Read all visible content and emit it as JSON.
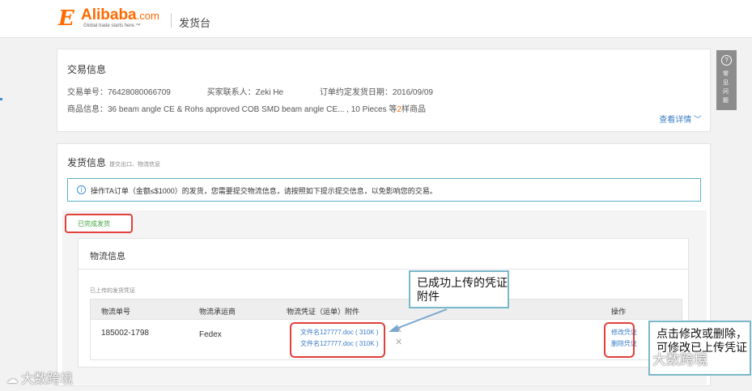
{
  "header": {
    "logo_text": "Alibaba",
    "logo_dotcom": ".com",
    "logo_tagline": "Global trade starts here.™",
    "page_title": "发货台"
  },
  "order": {
    "title": "交易信息",
    "order_no": "交易单号：76428080066709",
    "buyer": "买家联系人：Zeki He",
    "ship_date": "订单约定发货日期：2016/09/09",
    "goods_prefix": "商品信息：36 beam angle CE & Rohs approved COB SMD beam angle CE... , 10 Pieces  等",
    "goods_count": "2",
    "goods_suffix": "样商品",
    "detail_link": "查看详情 ﹀"
  },
  "shipping": {
    "title": "发货信息",
    "subtitle": "提交出口、物流信息",
    "notice": "操作TA订单（金额≤$1000）的发货，您需要提交物流信息，请按照如下提示提交信息，以免影响您的交易。",
    "status_badge": "已完成发货"
  },
  "logistics": {
    "title": "物流信息",
    "uploaded_label": "已上传的发货凭证",
    "columns": [
      "物流单号",
      "物流承运商",
      "物流凭证（运单）附件",
      "操作"
    ],
    "rows": [
      {
        "tracking_no": "185002-1798",
        "carrier": "Fedex",
        "files": [
          "文件名127777.doc ( 310K )",
          "文件名127777.doc ( 310K )"
        ],
        "actions": [
          "修改凭证",
          "删除凭证"
        ]
      }
    ]
  },
  "callouts": {
    "upload_done": "已成功上传的凭证附件",
    "modify_tip": "点击修改或删除，可修改已上传凭证"
  },
  "help_tab": {
    "icon": "?",
    "label": "常见问题"
  },
  "watermark": {
    "text": "大数跨境",
    "overlay": "大数跨境"
  },
  "colors": {
    "brand_orange": "#ff6a00",
    "highlight_red": "#e2403a",
    "link_blue": "#3a7cc7",
    "success_green": "#3ea33e",
    "callout_border": "#79b8c9"
  }
}
